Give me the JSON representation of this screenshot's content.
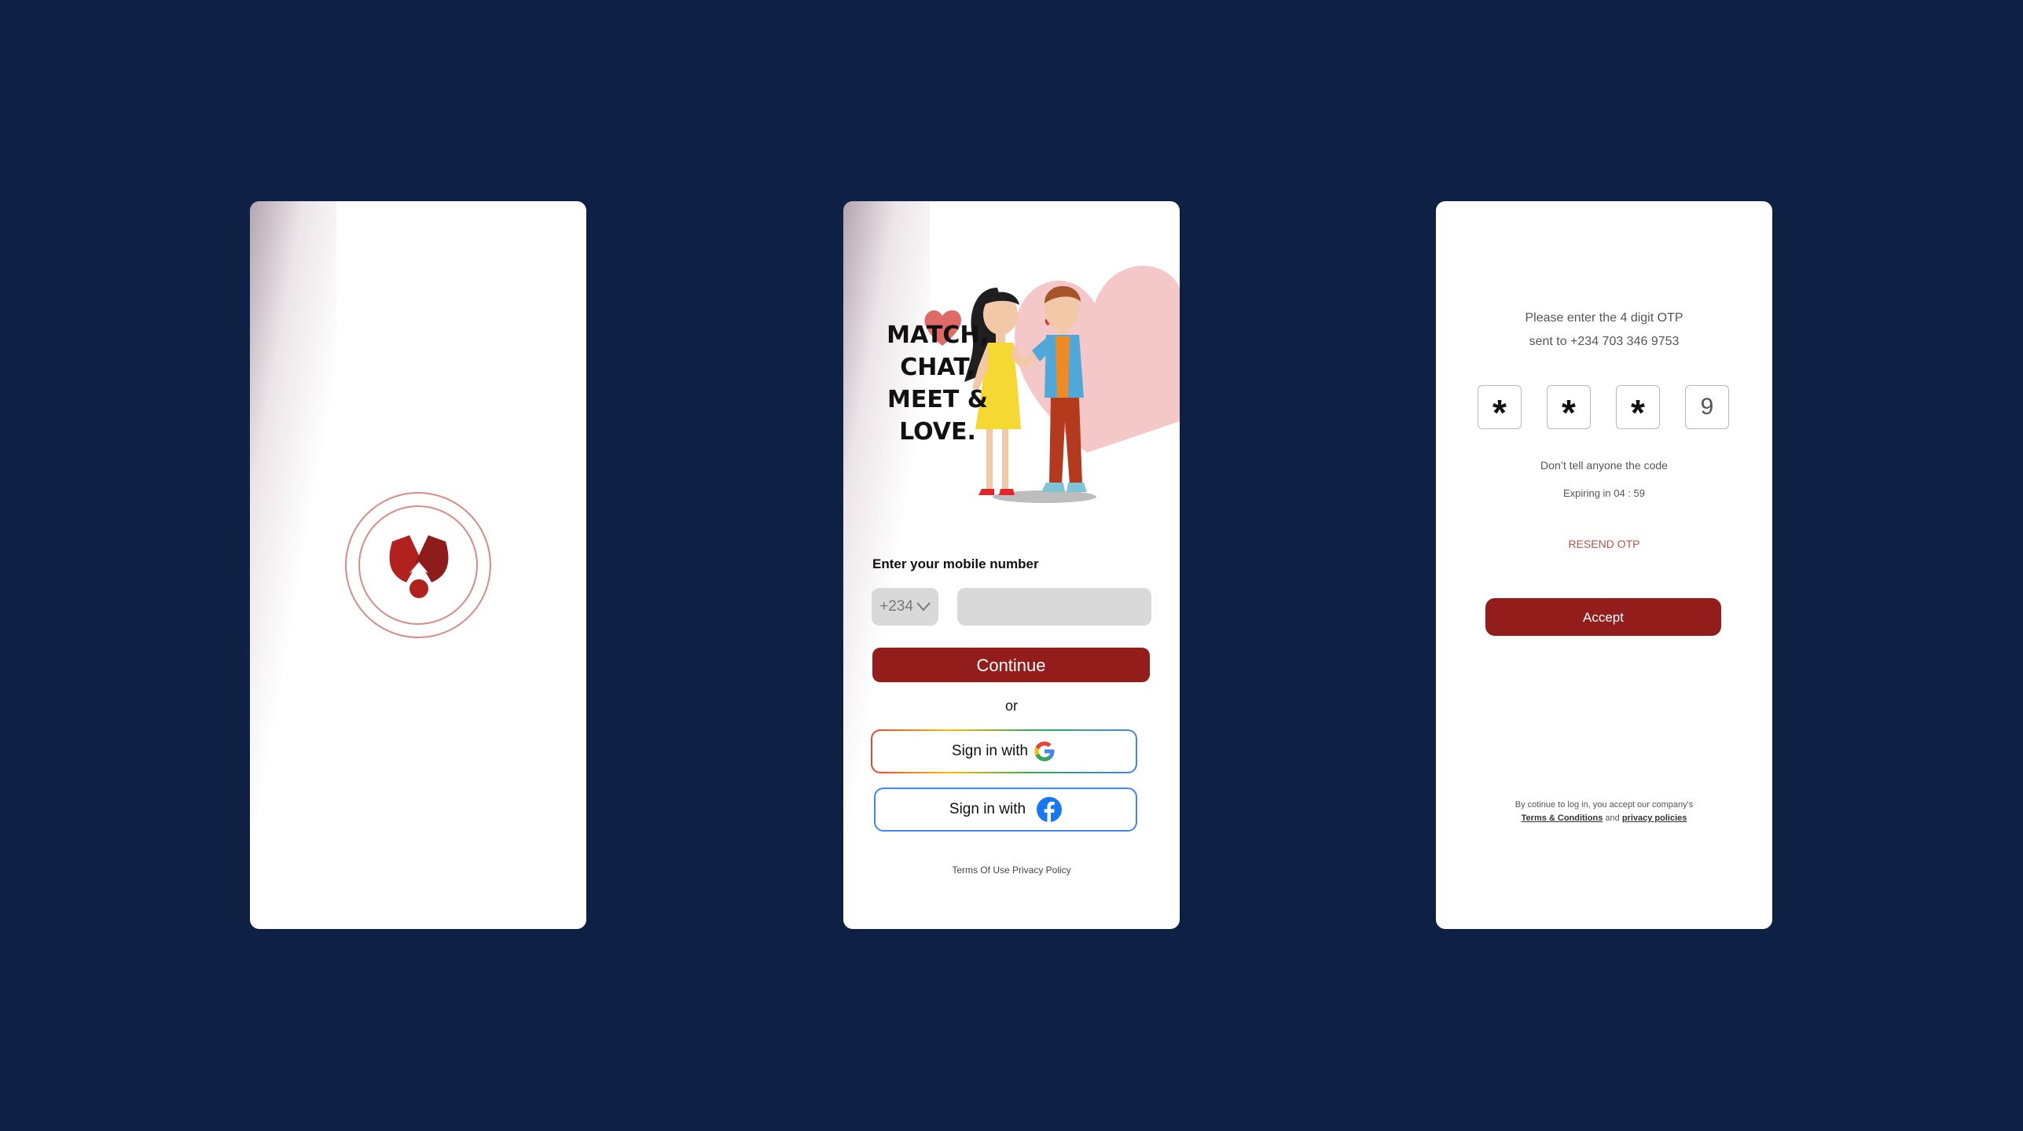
{
  "colors": {
    "background": "#0e2145",
    "brand_red": "#931d1b",
    "accent_pink": "#d98b85",
    "heart_pink": "#f4c7c8"
  },
  "splash": {
    "logo_icon": "brand-logo-icon"
  },
  "signup": {
    "tagline": [
      "MATCH,",
      "CHAT,",
      "MEET &",
      "LOVE."
    ],
    "phone_label": "Enter your mobile number",
    "country_code": "+234",
    "phone_value": "",
    "continue_label": "Continue",
    "or_text": "or",
    "google_label": "Sign in with",
    "facebook_label": "Sign in with",
    "footer_links": "Terms Of Use Privacy Policy"
  },
  "otp": {
    "prompt_line1": "Please enter the 4 digit OTP",
    "prompt_line2": "sent to +234 703 346 9753",
    "digits": [
      "*",
      "*",
      "*",
      "9"
    ],
    "warning": "Don’t tell anyone the code",
    "expiry": "Expiring in 04 : 59",
    "resend_label": "RESEND OTP",
    "accept_label": "Accept",
    "legal_prefix": "By cotinue to log in, you accept our company's",
    "terms_link": "Terms & Conditions",
    "legal_and": " and ",
    "privacy_link": "privacy policies"
  }
}
